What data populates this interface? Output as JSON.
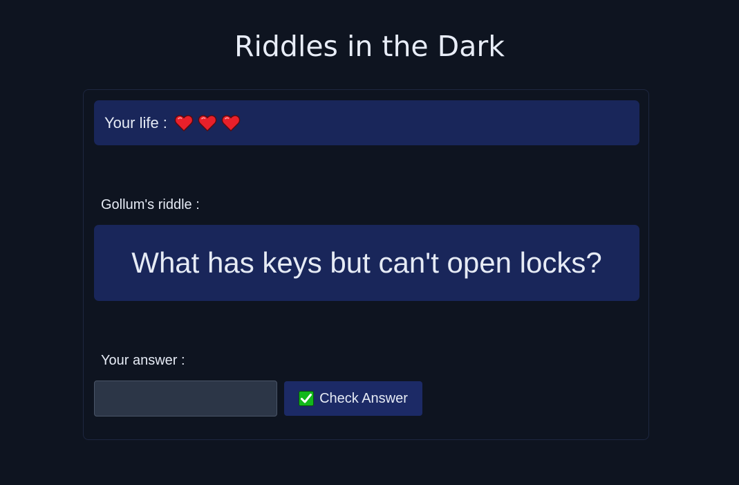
{
  "page": {
    "title": "Riddles in the Dark"
  },
  "life": {
    "label": "Your life :",
    "hearts": 3,
    "heart_icon": "red-heart-icon",
    "heart_color": "#e8202a"
  },
  "riddle": {
    "label": "Gollum's riddle :",
    "text": "What has keys but can't open locks?"
  },
  "answer": {
    "label": "Your answer :",
    "value": "",
    "placeholder": ""
  },
  "check_button": {
    "label": "Check Answer",
    "icon": "check-mark-button-icon",
    "icon_color": "#12b81b"
  },
  "colors": {
    "background": "#0e1420",
    "panel": "#19265a",
    "button": "#1c2a66",
    "input": "#2c3647",
    "text": "#e6ebf5"
  }
}
